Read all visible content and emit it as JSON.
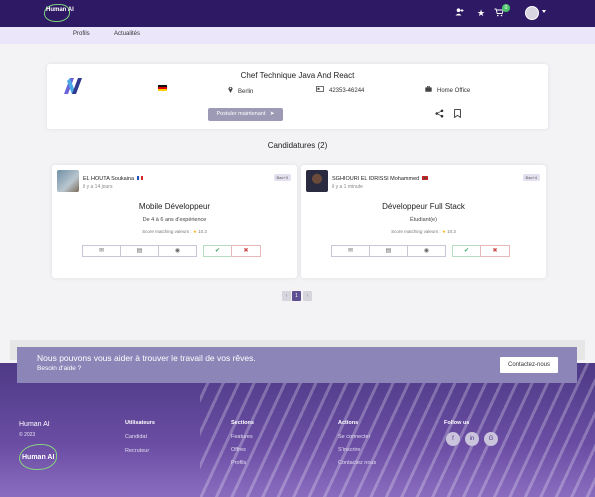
{
  "header": {
    "logo_text": "Human AI",
    "icons": [
      "user-plus-icon",
      "star-icon",
      "cart-icon",
      "user-avatar",
      "chevron-down-icon"
    ],
    "cart_badge": "0"
  },
  "subnav": {
    "items": [
      "Profils",
      "Actualités"
    ]
  },
  "job": {
    "title": "Chef Technique Java And React",
    "location": "Berlin",
    "phone": "42353-46244",
    "work_mode": "Home Office",
    "apply_label": "Postuler maintenant"
  },
  "candidates_heading": "Candidatures (2)",
  "candidates": [
    {
      "name": "EL HOUTA Soukaina",
      "ago": "il y a 14 jours",
      "tag": "Bac+3",
      "role": "Mobile Développeur",
      "experience": "De 4 à 6 ans d'expérience",
      "score_label": "Score matching valeurs :",
      "score": "10.3"
    },
    {
      "name": "SGHIOURI EL IDRISSI Mohammed",
      "ago": "il y a 1 minute",
      "tag": "Bac+4",
      "role": "Développeur Full Stack",
      "experience": "Étudiant(e)",
      "score_label": "Score matching valeurs :",
      "score": "10.3"
    }
  ],
  "pagination": {
    "prev": "‹",
    "current": "1",
    "next": "›"
  },
  "cta": {
    "title": "Nous pouvons vous aider à trouver le travail de vos rêves.",
    "subtitle": "Besoin d'aide ?",
    "button": "Contactez-nous"
  },
  "footer": {
    "brand": "Human AI",
    "copyright": "© 2023",
    "columns": [
      {
        "title": "Utilisateurs",
        "links": [
          "Candidat",
          "Recruteur"
        ]
      },
      {
        "title": "Sections",
        "links": [
          "Features",
          "Offres",
          "Profils"
        ]
      },
      {
        "title": "Actions",
        "links": [
          "Se connecter",
          "S'inscrire",
          "Contactez nous"
        ]
      },
      {
        "title": "Follow us",
        "links": []
      }
    ],
    "social_icons": [
      "facebook-icon",
      "linkedin-icon",
      "google-icon"
    ]
  },
  "colors": {
    "topbar": "#2e1a64",
    "subnav": "#ece6fb",
    "apply_button": "#9d9ab5",
    "footer": "#4e3a86",
    "accept": "#3aa35a",
    "reject": "#d04848"
  }
}
